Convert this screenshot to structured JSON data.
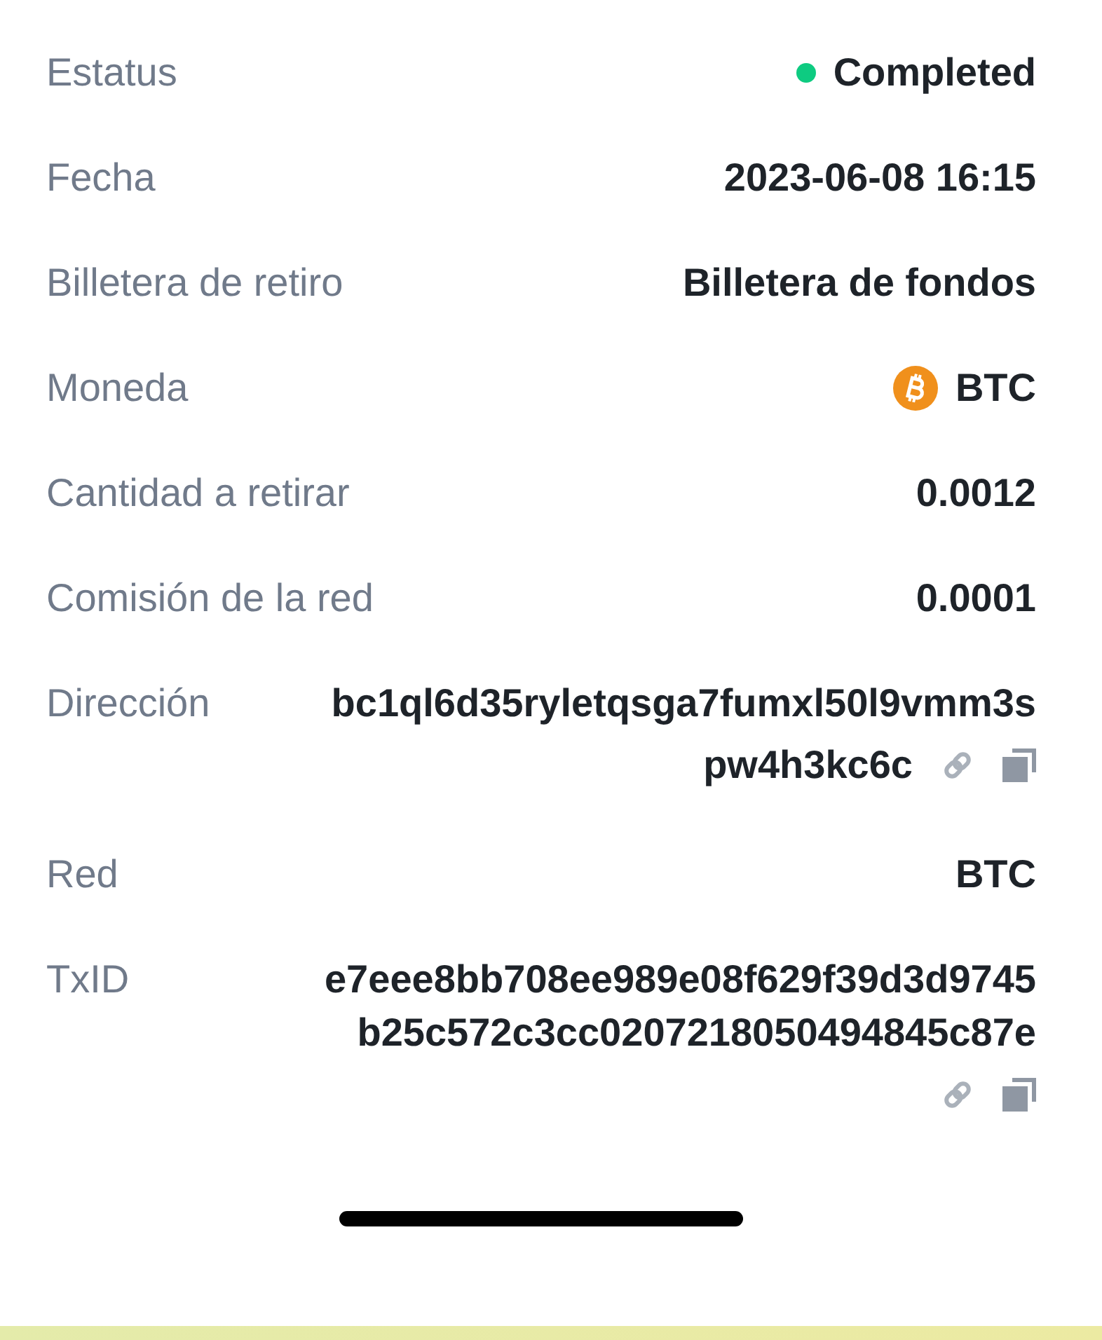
{
  "rows": [
    {
      "kind": "status",
      "label": "Estatus",
      "value": "Completed",
      "color": "#0ecb81"
    },
    {
      "kind": "text",
      "label": "Fecha",
      "value": "2023-06-08 16:15"
    },
    {
      "kind": "text",
      "label": "Billetera de retiro",
      "value": "Billetera de fondos"
    },
    {
      "kind": "coin",
      "label": "Moneda",
      "value": "BTC"
    },
    {
      "kind": "text",
      "label": "Cantidad a retirar",
      "value": "0.0012"
    },
    {
      "kind": "text",
      "label": "Comisión de la red",
      "value": "0.0001"
    },
    {
      "kind": "address",
      "label": "Dirección",
      "lines": [
        "bc1ql6d35ryletqsga7fumxl50l9vmm3s",
        "pw4h3kc6c"
      ]
    },
    {
      "kind": "text",
      "label": "Red",
      "value": "BTC"
    },
    {
      "kind": "txid",
      "label": "TxID",
      "lines": [
        "e7eee8bb708ee989e08f629f39d3d9745",
        "b25c572c3cc0207218050494845c87e"
      ]
    }
  ]
}
